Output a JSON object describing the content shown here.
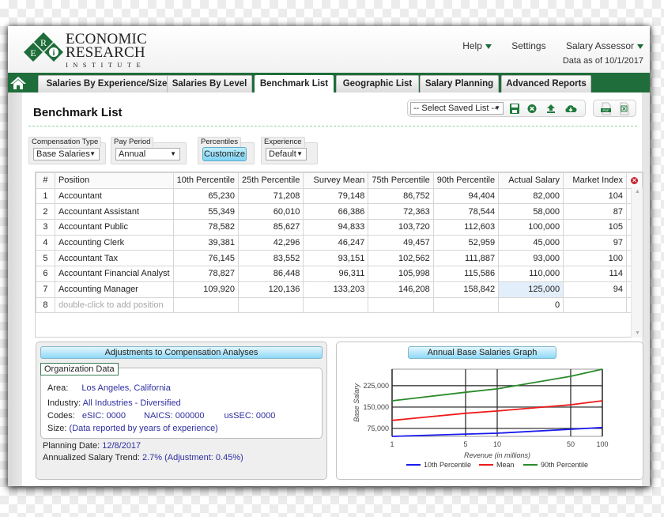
{
  "brand": {
    "logo_letters": [
      "E",
      "R",
      "i"
    ],
    "line1": "ECONOMIC",
    "line2": "RESEARCH",
    "line3": "INSTITUTE"
  },
  "top_links": {
    "help": "Help",
    "settings": "Settings",
    "salary_assessor": "Salary Assessor",
    "data_as_of": "Data as of 10/1/2017"
  },
  "nav": {
    "tabs": [
      {
        "label": "Salaries By Experience/Size",
        "active": false
      },
      {
        "label": "Salaries By Level",
        "active": false
      },
      {
        "label": "Benchmark List",
        "active": true
      },
      {
        "label": "Geographic List",
        "active": false
      },
      {
        "label": "Salary Planning",
        "active": false
      },
      {
        "label": "Advanced Reports",
        "active": false
      }
    ]
  },
  "page": {
    "title": "Benchmark List"
  },
  "toolbar": {
    "saved_list_value": "-- Select Saved List --",
    "icons": [
      "save-icon",
      "clear-icon",
      "upload-icon",
      "cloud-download-icon"
    ],
    "export_icons": [
      "pdf-icon",
      "excel-icon"
    ]
  },
  "filters": {
    "compensation_type": {
      "label": "Compensation Type",
      "value": "Base Salaries"
    },
    "pay_period": {
      "label": "Pay Period",
      "value": "Annual"
    },
    "percentiles": {
      "label": "Percentiles",
      "button": "Customize"
    },
    "experience": {
      "label": "Experience",
      "value": "Default"
    }
  },
  "grid": {
    "columns": [
      "#",
      "Position",
      "10th Percentile",
      "25th Percentile",
      "Survey Mean",
      "75th Percentile",
      "90th Percentile",
      "Actual Salary",
      "Market Index"
    ],
    "rows": [
      {
        "n": "1",
        "position": "Accountant",
        "p10": "65,230",
        "p25": "71,208",
        "mean": "79,148",
        "p75": "86,752",
        "p90": "94,404",
        "actual": "82,000",
        "index": "104"
      },
      {
        "n": "2",
        "position": "Accountant Assistant",
        "p10": "55,349",
        "p25": "60,010",
        "mean": "66,386",
        "p75": "72,363",
        "p90": "78,544",
        "actual": "58,000",
        "index": "87"
      },
      {
        "n": "3",
        "position": "Accountant Public",
        "p10": "78,582",
        "p25": "85,627",
        "mean": "94,833",
        "p75": "103,720",
        "p90": "112,603",
        "actual": "100,000",
        "index": "105"
      },
      {
        "n": "4",
        "position": "Accounting Clerk",
        "p10": "39,381",
        "p25": "42,296",
        "mean": "46,247",
        "p75": "49,457",
        "p90": "52,959",
        "actual": "45,000",
        "index": "97"
      },
      {
        "n": "5",
        "position": "Accountant Tax",
        "p10": "76,145",
        "p25": "83,552",
        "mean": "93,151",
        "p75": "102,562",
        "p90": "111,887",
        "actual": "93,000",
        "index": "100"
      },
      {
        "n": "6",
        "position": "Accountant Financial Analyst",
        "p10": "78,827",
        "p25": "86,448",
        "mean": "96,311",
        "p75": "105,998",
        "p90": "115,586",
        "actual": "110,000",
        "index": "114"
      },
      {
        "n": "7",
        "position": "Accounting Manager",
        "p10": "109,920",
        "p25": "120,136",
        "mean": "133,203",
        "p75": "146,208",
        "p90": "158,842",
        "actual": "125,000",
        "index": "94"
      },
      {
        "n": "8",
        "position": "double-click to add position",
        "p10": "",
        "p25": "",
        "mean": "",
        "p75": "",
        "p90": "",
        "actual": "0",
        "index": "",
        "placeholder": true
      }
    ],
    "colors": {
      "delete_all": "#c8202a",
      "delete_row": "#2b7a45",
      "highlight_cell": "#e3eefb"
    }
  },
  "adjustments": {
    "title": "Adjustments to Compensation Analyses",
    "org_label": "Organization Data",
    "area_label": "Area:",
    "area_value": "Los Angeles, California",
    "industry_label": "Industry:",
    "industry_value": "All Industries - Diversified",
    "codes_label": "Codes:",
    "esic": "eSIC: 0000",
    "naics": "NAICS: 000000",
    "ussec": "usSEC: 0000",
    "size_label": "Size:",
    "size_value": "(Data reported by years of experience)",
    "planning_date_label": "Planning Date:",
    "planning_date_value": "12/8/2017",
    "trend_label": "Annualized Salary Trend:",
    "trend_value": "2.7% (Adjustment: 0.45%)"
  },
  "chart_data": {
    "type": "line",
    "title": "Annual Base Salaries Graph",
    "xlabel": "Revenue (in millions)",
    "ylabel": "Base Salary",
    "x_scale": "log",
    "x": [
      1,
      5,
      10,
      50,
      100
    ],
    "x_ticks": [
      "1",
      "5",
      "10",
      "50",
      "100"
    ],
    "y_ticks": [
      75000,
      150000,
      225000
    ],
    "y_tick_labels": [
      "75,000",
      "150,000",
      "225,000"
    ],
    "ylim": [
      47000,
      283000
    ],
    "xlim": [
      1,
      100
    ],
    "grid": true,
    "legend": "bottom",
    "series": [
      {
        "name": "10th Percentile",
        "color": "#1a1aee",
        "values": [
          47000,
          55000,
          58000,
          72000,
          78000
        ]
      },
      {
        "name": "Mean",
        "color": "#ee1a1a",
        "values": [
          103000,
          128000,
          136000,
          158000,
          172000
        ]
      },
      {
        "name": "90th Percentile",
        "color": "#2a8a2a",
        "values": [
          172000,
          202000,
          214000,
          258000,
          283000
        ]
      }
    ]
  }
}
